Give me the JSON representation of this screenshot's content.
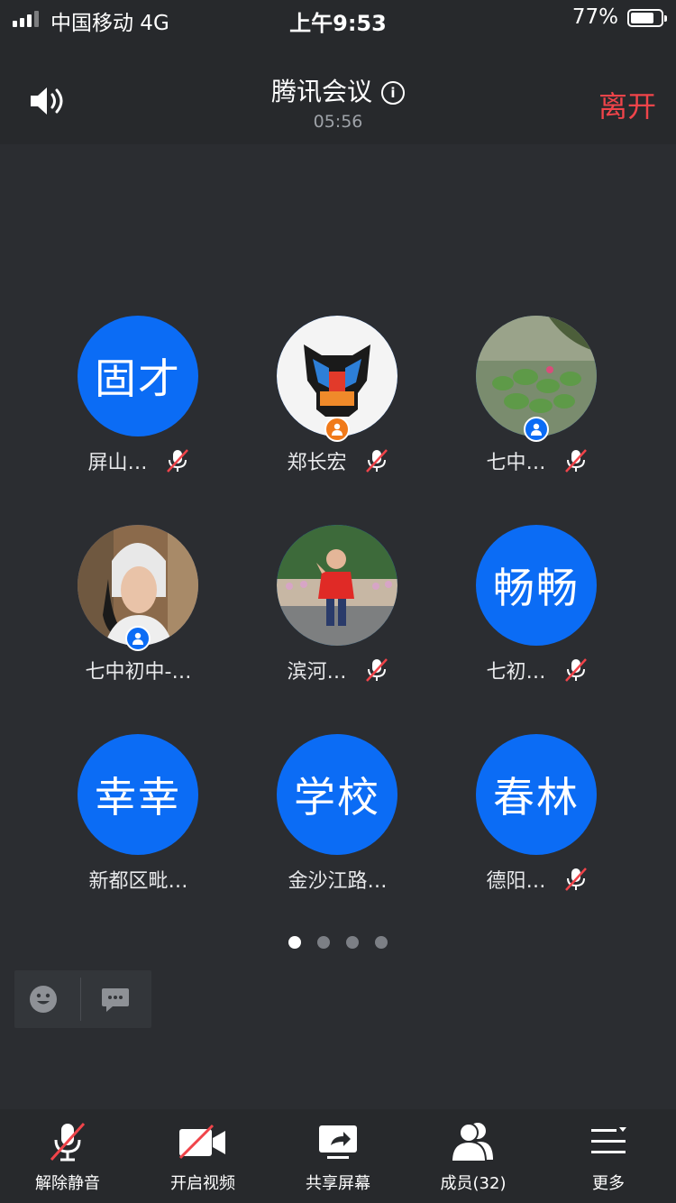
{
  "status_bar": {
    "carrier": "中国移动  4G",
    "time": "上午9:53",
    "battery_pct": "77%",
    "battery_level": 0.77
  },
  "header": {
    "title": "腾讯会议",
    "duration": "05:56",
    "leave_label": "离开"
  },
  "participants": [
    {
      "avatar_text": "固才",
      "name": "屏山…",
      "muted": true,
      "avatar": "text"
    },
    {
      "avatar_text": "",
      "name": "郑长宏",
      "muted": true,
      "avatar": "transformers-logo",
      "badge_color": "#f07a1a"
    },
    {
      "avatar_text": "",
      "name": "七中…",
      "muted": true,
      "avatar": "lotus-pond-photo",
      "badge_color": "#0b6cf5"
    },
    {
      "avatar_text": "",
      "name": "七中初中-…",
      "muted": false,
      "avatar": "woman-photo",
      "badge_color": "#0b6cf5"
    },
    {
      "avatar_text": "",
      "name": "滨河…",
      "muted": true,
      "avatar": "child-photo"
    },
    {
      "avatar_text": "畅畅",
      "name": "七初…",
      "muted": true,
      "avatar": "text"
    },
    {
      "avatar_text": "幸幸",
      "name": "新都区毗…",
      "muted": false,
      "avatar": "text"
    },
    {
      "avatar_text": "学校",
      "name": "金沙江路…",
      "muted": false,
      "avatar": "text"
    },
    {
      "avatar_text": "春林",
      "name": "德阳…",
      "muted": true,
      "avatar": "text"
    }
  ],
  "pager": {
    "pages": 4,
    "current": 1
  },
  "toolbar": {
    "unmute_label": "解除静音",
    "video_label": "开启视频",
    "share_label": "共享屏幕",
    "members_label": "成员(32)",
    "more_label": "更多"
  },
  "colors": {
    "accent": "#0b6cf5",
    "leave": "#f0444a",
    "background": "#2b2d31",
    "bar": "#27292c"
  }
}
